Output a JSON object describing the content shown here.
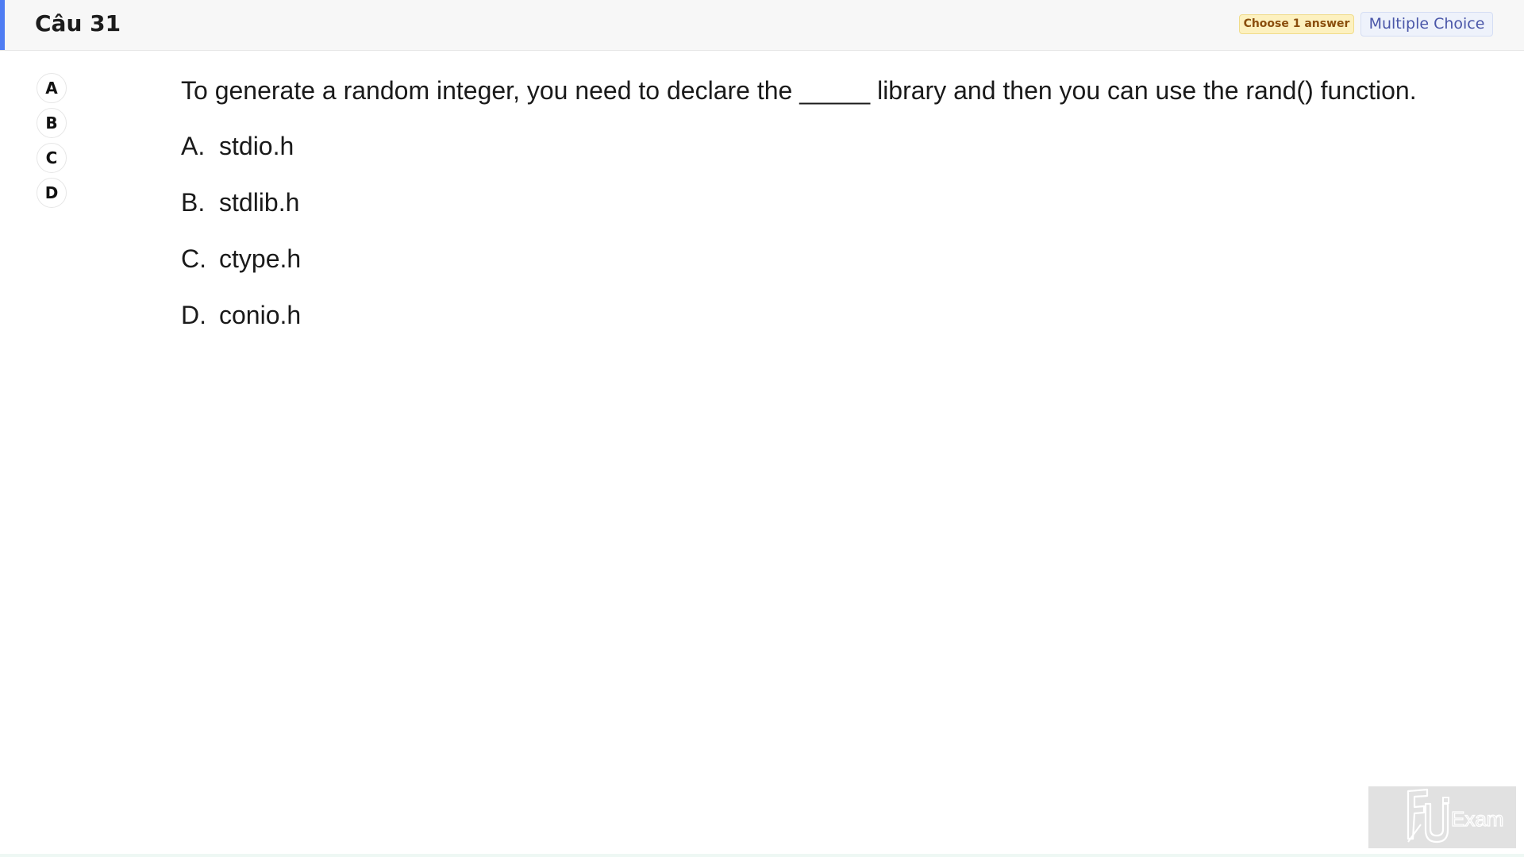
{
  "header": {
    "title": "Câu 31",
    "choose_badge": "Choose 1 answer",
    "type_badge": "Multiple Choice"
  },
  "answer_buttons": [
    "A",
    "B",
    "C",
    "D"
  ],
  "question": {
    "text": "To generate a random integer, you need to declare the _____ library and then you can use the rand() function.",
    "options": [
      {
        "letter": "A.",
        "text": "stdio.h"
      },
      {
        "letter": "B.",
        "text": "stdlib.h"
      },
      {
        "letter": "C.",
        "text": "ctype.h"
      },
      {
        "letter": "D.",
        "text": "conio.h"
      }
    ]
  },
  "watermark": {
    "logo_text": "FU",
    "logo_suffix": "Exam"
  },
  "colors": {
    "accent": "#4f7df3",
    "choose_badge_bg": "#fdf1bf",
    "type_badge_text": "#4a56a8"
  }
}
